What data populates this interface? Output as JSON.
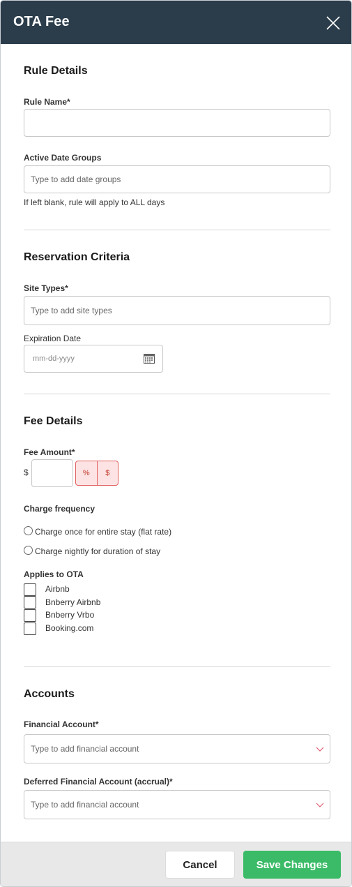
{
  "modal": {
    "title": "OTA Fee"
  },
  "rule_details": {
    "title": "Rule Details",
    "rule_name_label": "Rule Name*",
    "rule_name_value": "",
    "date_groups_label": "Active Date Groups",
    "date_groups_placeholder": "Type to add date groups",
    "date_groups_help": "If left blank, rule will apply to ALL days"
  },
  "reservation_criteria": {
    "title": "Reservation Criteria",
    "site_types_label": "Site Types*",
    "site_types_placeholder": "Type to add site types",
    "expiration_label": "Expiration Date",
    "expiration_placeholder": "mm-dd-yyyy"
  },
  "fee_details": {
    "title": "Fee Details",
    "fee_amount_label": "Fee Amount*",
    "currency_prefix": "$",
    "fee_amount_value": "",
    "unit_options": [
      "%",
      "$"
    ],
    "charge_frequency_label": "Charge frequency",
    "charge_options": [
      "Charge once for entire stay (flat rate)",
      "Charge nightly for duration of stay"
    ],
    "applies_label": "Applies to OTA",
    "otas": [
      "Airbnb",
      "Bnberry Airbnb",
      "Bnberry Vrbo",
      "Booking.com"
    ]
  },
  "accounts": {
    "title": "Accounts",
    "financial_label": "Financial Account*",
    "financial_placeholder": "Type to add financial account",
    "deferred_label": "Deferred Financial Account (accrual)*",
    "deferred_placeholder": "Type to add financial account"
  },
  "footer": {
    "cancel_label": "Cancel",
    "save_label": "Save Changes"
  },
  "colors": {
    "header_bg": "#2b3d4b",
    "save_bg": "#3bbb67",
    "toggle_bg": "#fde3e3",
    "toggle_border": "#e06060",
    "chevron": "#e06070"
  }
}
